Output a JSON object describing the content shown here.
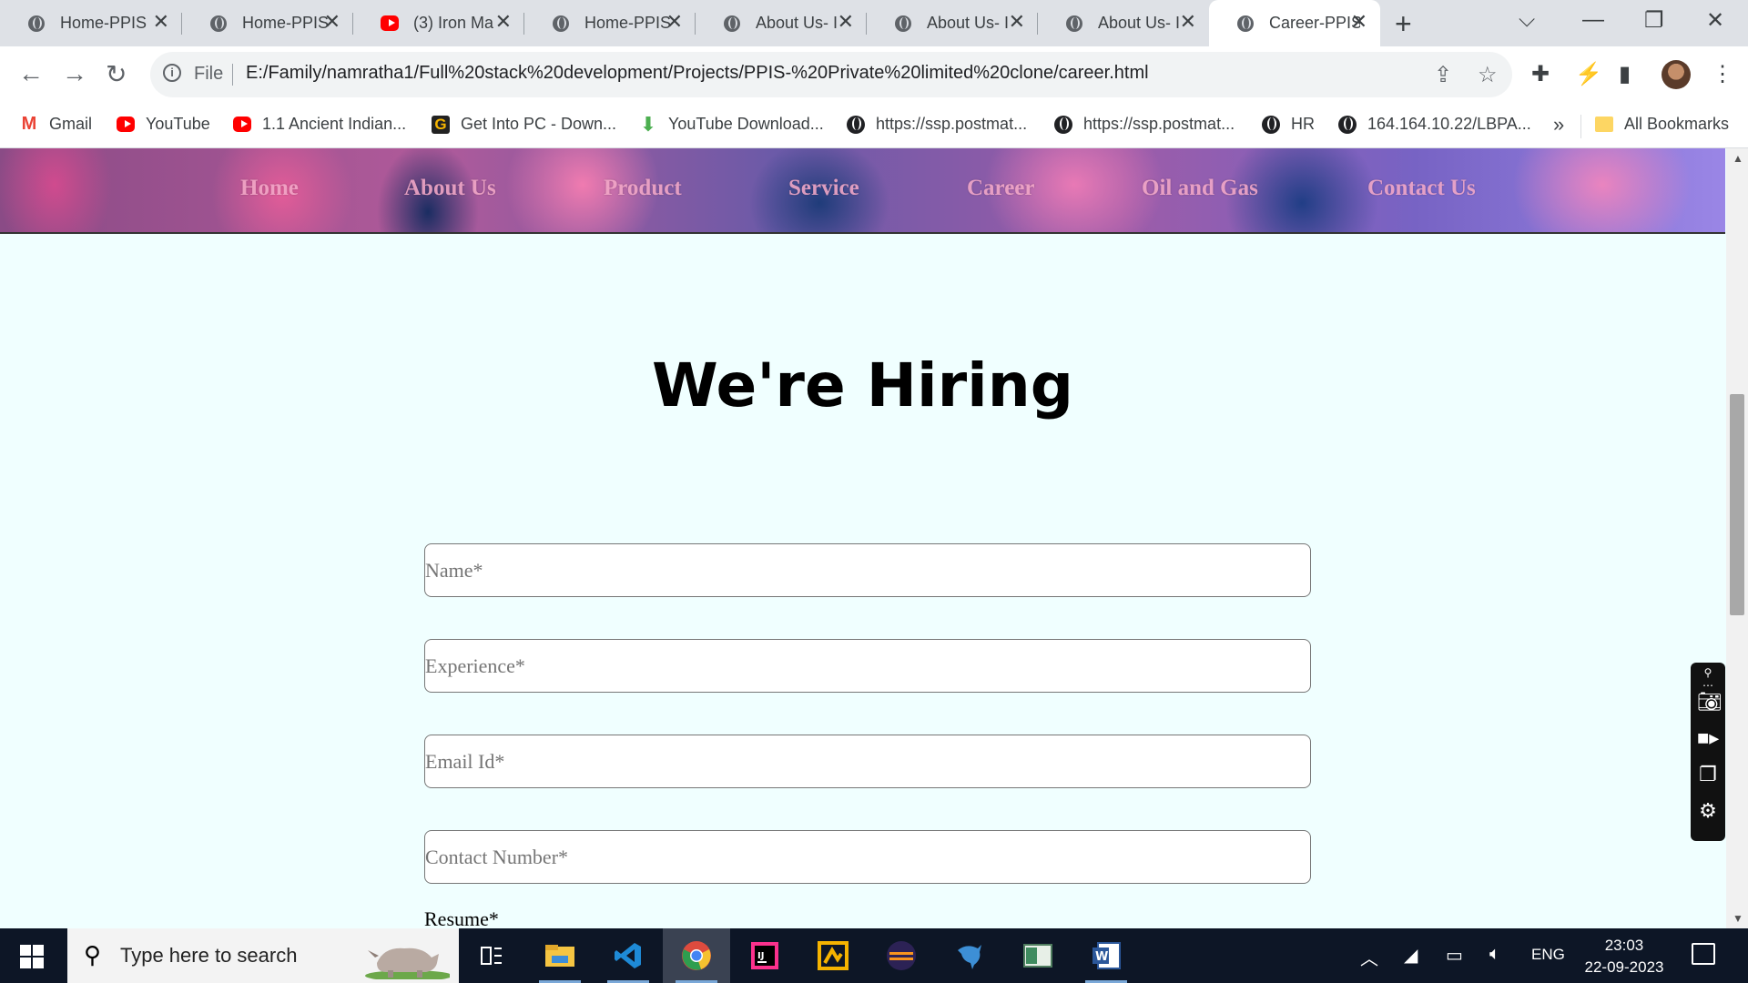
{
  "browser": {
    "tabs": [
      {
        "title": "Home-PPIS",
        "icon": "globe-icon"
      },
      {
        "title": "Home-PPIS",
        "icon": "globe-icon"
      },
      {
        "title": "(3) Iron Ma",
        "icon": "youtube-icon"
      },
      {
        "title": "Home-PPIS",
        "icon": "globe-icon"
      },
      {
        "title": "About Us- I",
        "icon": "globe-icon"
      },
      {
        "title": "About Us- I",
        "icon": "globe-icon"
      },
      {
        "title": "About Us- I",
        "icon": "globe-icon"
      },
      {
        "title": "Career-PPIS",
        "icon": "globe-icon",
        "active": true
      }
    ],
    "address": {
      "scheme_label": "File",
      "url": "E:/Family/namratha1/Full%20stack%20development/Projects/PPIS-%20Private%20limited%20clone/career.html"
    },
    "bookmarks": [
      {
        "label": "Gmail",
        "icon": "gmail-icon"
      },
      {
        "label": "YouTube",
        "icon": "youtube-icon"
      },
      {
        "label": "1.1 Ancient Indian...",
        "icon": "youtube-icon"
      },
      {
        "label": "Get Into PC - Down...",
        "icon": "getintopc-icon"
      },
      {
        "label": "YouTube Download...",
        "icon": "download-arrow-icon"
      },
      {
        "label": "https://ssp.postmat...",
        "icon": "globe-icon"
      },
      {
        "label": "https://ssp.postmat...",
        "icon": "globe-icon"
      },
      {
        "label": "HR",
        "icon": "globe-icon"
      },
      {
        "label": "164.164.10.22/LBPA...",
        "icon": "globe-icon"
      }
    ],
    "bookmarks_more": "»",
    "all_bookmarks": "All Bookmarks"
  },
  "page": {
    "nav": [
      "Home",
      "About Us",
      "Product",
      "Service",
      "Career",
      "Oil and Gas",
      "Contact Us"
    ],
    "title": "We're Hiring",
    "form": {
      "name_placeholder": "Name*",
      "experience_placeholder": "Experience*",
      "email_placeholder": "Email Id*",
      "contact_placeholder": "Contact Number*",
      "resume_label": "Resume*"
    }
  },
  "taskbar": {
    "search_placeholder": "Type here to search",
    "apps": [
      "task-view-icon",
      "file-explorer-icon",
      "vscode-icon",
      "chrome-icon",
      "intellij-icon",
      "app-icon",
      "eclipse-icon",
      "mysql-workbench-icon",
      "notepad-icon",
      "word-icon"
    ],
    "language": "ENG",
    "time": "23:03",
    "date": "22-09-2023"
  },
  "colors": {
    "page_background": "#f0ffff",
    "nav_link": "#f3a9c8",
    "taskbar": "#0d1626"
  }
}
